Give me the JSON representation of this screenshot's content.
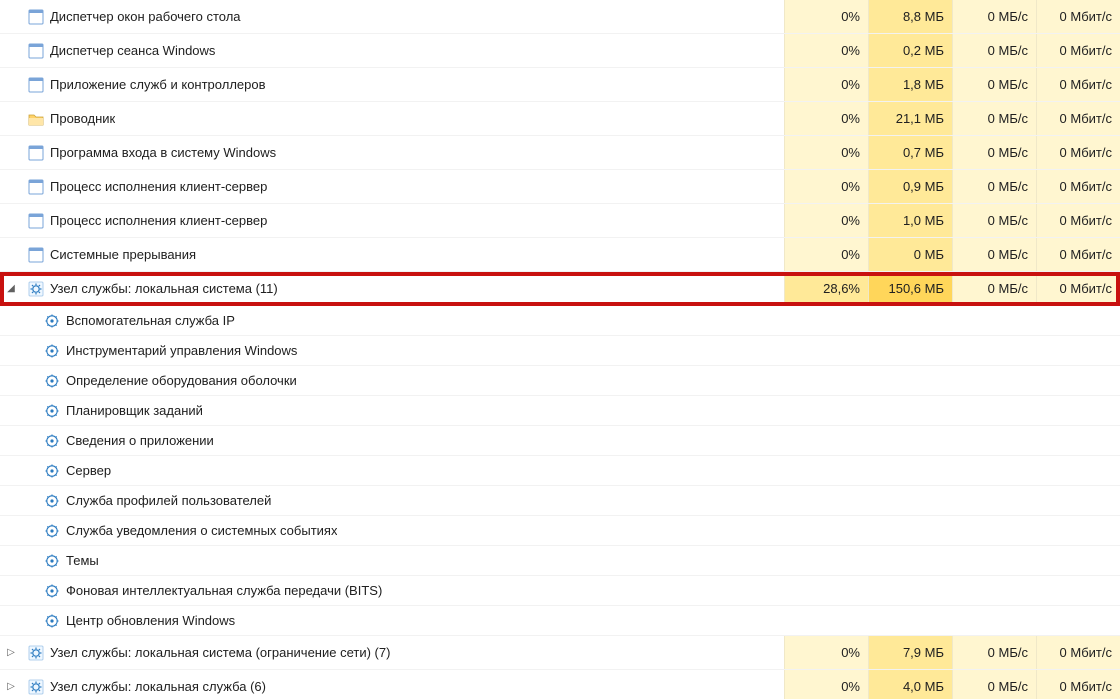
{
  "units": {
    "percent": "%",
    "mb": "МБ",
    "mbs": "МБ/c",
    "mbits": "Мбит/с"
  },
  "processes": [
    {
      "expander": "none",
      "icon": "app",
      "name": "Диспетчер окон рабочего стола",
      "cpu": "0%",
      "mem": "8,8 МБ",
      "disk": "0 МБ/c",
      "net": "0 Мбит/с"
    },
    {
      "expander": "none",
      "icon": "app",
      "name": "Диспетчер сеанса  Windows",
      "cpu": "0%",
      "mem": "0,2 МБ",
      "disk": "0 МБ/c",
      "net": "0 Мбит/с"
    },
    {
      "expander": "none",
      "icon": "app",
      "name": "Приложение служб и контроллеров",
      "cpu": "0%",
      "mem": "1,8 МБ",
      "disk": "0 МБ/c",
      "net": "0 Мбит/с"
    },
    {
      "expander": "none",
      "icon": "folder",
      "name": "Проводник",
      "cpu": "0%",
      "mem": "21,1 МБ",
      "disk": "0 МБ/c",
      "net": "0 Мбит/с"
    },
    {
      "expander": "none",
      "icon": "app",
      "name": "Программа входа в систему Windows",
      "cpu": "0%",
      "mem": "0,7 МБ",
      "disk": "0 МБ/c",
      "net": "0 Мбит/с"
    },
    {
      "expander": "none",
      "icon": "app",
      "name": "Процесс исполнения клиент-сервер",
      "cpu": "0%",
      "mem": "0,9 МБ",
      "disk": "0 МБ/c",
      "net": "0 Мбит/с"
    },
    {
      "expander": "none",
      "icon": "app",
      "name": "Процесс исполнения клиент-сервер",
      "cpu": "0%",
      "mem": "1,0 МБ",
      "disk": "0 МБ/c",
      "net": "0 Мбит/с"
    },
    {
      "expander": "none",
      "icon": "app",
      "name": "Системные прерывания",
      "cpu": "0%",
      "mem": "0 МБ",
      "disk": "0 МБ/c",
      "net": "0 Мбит/с"
    },
    {
      "expander": "expanded",
      "icon": "gear",
      "highlight": true,
      "name": "Узел службы: локальная система (11)",
      "cpu": "28,6%",
      "mem": "150,6 МБ",
      "disk": "0 МБ/c",
      "net": "0 Мбит/с"
    }
  ],
  "children": [
    {
      "icon": "service",
      "name": "Вспомогательная служба IP"
    },
    {
      "icon": "service",
      "name": "Инструментарий управления Windows"
    },
    {
      "icon": "service",
      "name": "Определение оборудования оболочки"
    },
    {
      "icon": "service",
      "name": "Планировщик заданий"
    },
    {
      "icon": "service",
      "name": "Сведения о приложении"
    },
    {
      "icon": "service",
      "name": "Сервер"
    },
    {
      "icon": "service",
      "name": "Служба профилей пользователей"
    },
    {
      "icon": "service",
      "name": "Служба уведомления о системных событиях"
    },
    {
      "icon": "service",
      "name": "Темы"
    },
    {
      "icon": "service",
      "name": "Фоновая интеллектуальная служба передачи (BITS)"
    },
    {
      "icon": "service",
      "name": "Центр обновления Windows"
    }
  ],
  "tail": [
    {
      "expander": "collapsed",
      "icon": "gear",
      "name": "Узел службы: локальная система (ограничение сети) (7)",
      "cpu": "0%",
      "mem": "7,9 МБ",
      "disk": "0 МБ/c",
      "net": "0 Мбит/с"
    },
    {
      "expander": "collapsed",
      "icon": "gear",
      "name": "Узел службы: локальная служба (6)",
      "cpu": "0%",
      "mem": "4,0 МБ",
      "disk": "0 МБ/c",
      "net": "0 Мбит/с"
    }
  ]
}
